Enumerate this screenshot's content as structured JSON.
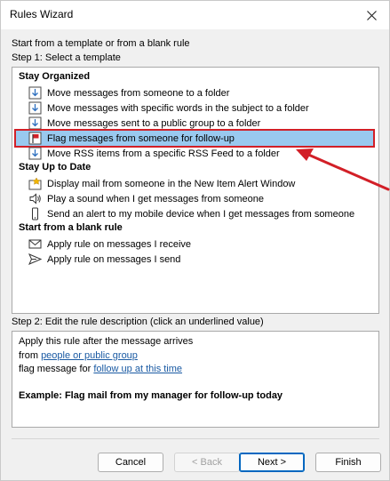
{
  "window": {
    "title": "Rules Wizard"
  },
  "intro": "Start from a template or from a blank rule",
  "step1": "Step 1: Select a template",
  "groups": [
    {
      "label": "Stay Organized"
    },
    {
      "label": "Stay Up to Date"
    },
    {
      "label": "Start from a blank rule"
    }
  ],
  "templates": [
    {
      "label": "Move messages from someone to a folder",
      "icon": "folder-move-icon"
    },
    {
      "label": "Move messages with specific words in the subject to a folder",
      "icon": "folder-move-icon"
    },
    {
      "label": "Move messages sent to a public group to a folder",
      "icon": "folder-move-icon"
    },
    {
      "label": "Flag messages from someone for follow-up",
      "icon": "flag-icon",
      "selected": true
    },
    {
      "label": "Move RSS items from a specific RSS Feed to a folder",
      "icon": "folder-move-icon"
    },
    {
      "label": "Display mail from someone in the New Item Alert Window",
      "icon": "alert-window-icon"
    },
    {
      "label": "Play a sound when I get messages from someone",
      "icon": "speaker-icon"
    },
    {
      "label": "Send an alert to my mobile device when I get messages from someone",
      "icon": "mobile-icon"
    },
    {
      "label": "Apply rule on messages I receive",
      "icon": "envelope-icon"
    },
    {
      "label": "Apply rule on messages I send",
      "icon": "send-icon"
    }
  ],
  "step2": "Step 2: Edit the rule description (click an underlined value)",
  "description": {
    "line1": "Apply this rule after the message arrives",
    "line2_prefix": "from ",
    "line2_link": "people or public group",
    "line3_prefix": "flag message for ",
    "line3_link": "follow up at this time",
    "example": "Example: Flag mail from my manager for follow-up today"
  },
  "buttons": {
    "cancel": "Cancel",
    "back": "< Back",
    "next": "Next >",
    "finish": "Finish"
  },
  "colors": {
    "selection": "#99c9ef",
    "highlight_border": "#d21f27",
    "link": "#1a5aa3"
  }
}
